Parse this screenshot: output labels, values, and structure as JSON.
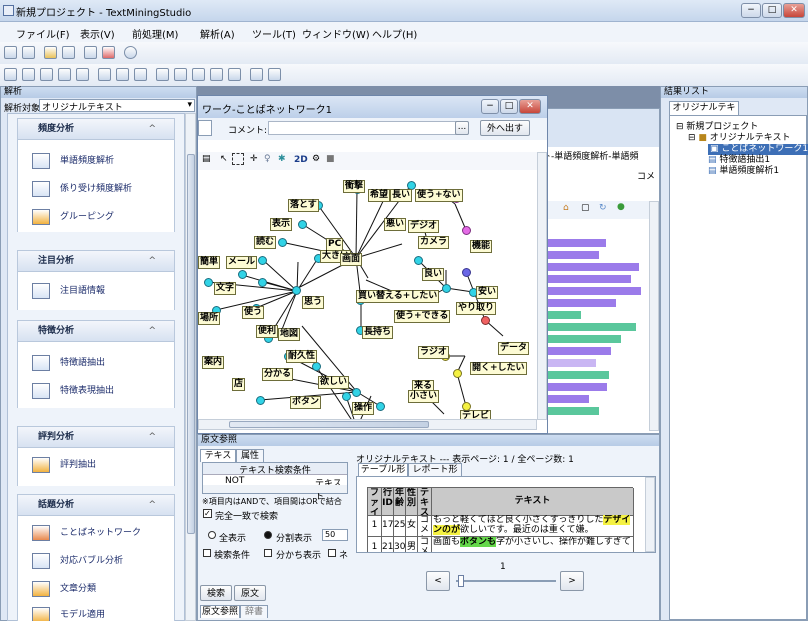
{
  "app": {
    "title": "新規プロジェクト - TextMiningStudio"
  },
  "window_controls": {
    "minimize": "−",
    "maximize": "□",
    "close": "✕"
  },
  "menu": {
    "items": [
      "ファイル(F)",
      "表示(V)",
      "前処理(M)",
      "解析(A)",
      "ツール(T)",
      "ウィンドウ(W)",
      "ヘルプ(H)"
    ]
  },
  "analysis_panel": {
    "title": "解析",
    "target_label": "解析対象",
    "target_value": "オリジナルテキスト",
    "groups": [
      {
        "title": "頻度分析",
        "items": [
          "単語頻度解析",
          "係り受け頻度解析",
          "グルーピング"
        ]
      },
      {
        "title": "注目分析",
        "items": [
          "注目語情報"
        ]
      },
      {
        "title": "特徴分析",
        "items": [
          "特徴語抽出",
          "特徴表現抽出"
        ]
      },
      {
        "title": "評判分析",
        "items": [
          "評判抽出"
        ]
      },
      {
        "title": "話題分析",
        "items": [
          "ことばネットワーク",
          "対応バブル分析",
          "文章分類",
          "モデル適用"
        ]
      }
    ],
    "collapse_icon": "^"
  },
  "network_window": {
    "title": "ワーク-ことばネットワーク1",
    "comment_label": "コメント:",
    "export_button": "外へ出す",
    "more_button": "...",
    "zoom_label": "2D",
    "nodes": [
      "衝撃",
      "希望",
      "長い",
      "使う+ない",
      "落とす",
      "悪い",
      "デジオ",
      "表示",
      "PC",
      "カメラ",
      "機能",
      "読む",
      "大きい",
      "画面",
      "メール",
      "良い",
      "文字",
      "思う",
      "買い替える+したい",
      "安い",
      "やり取り",
      "使う",
      "使う+できる",
      "便利",
      "地図",
      "長持ち",
      "データ",
      "場所",
      "ラジオ",
      "耐久性",
      "開く+したい",
      "案内",
      "分かる",
      "来る",
      "欲しい",
      "小さい",
      "店",
      "ボタン",
      "操作",
      "テレビ",
      "簡単"
    ]
  },
  "bg_window": {
    "title": "スト-単語頻度解析-単語頻",
    "label_right": "コメ"
  },
  "result_panel": {
    "title": "結果リスト",
    "tab": "オリジナルテキスト",
    "tree": [
      "新規プロジェクト",
      "オリジナルテキスト",
      "ことばネットワーク1",
      "特徴語抽出1",
      "単語頻度解析1"
    ]
  },
  "text_ref_panel": {
    "title": "原文参照",
    "tabs": [
      "テキスト",
      "属性"
    ],
    "search_condition_header": "テキスト検索条件",
    "cond_col1": "NOT",
    "cond_col2": "テキスト",
    "note": "※項目内はANDで、項目間はORで結合",
    "exact_match": "完全一致で検索",
    "radio_all": "全表示",
    "radio_split": "分割表示",
    "split_value": "50",
    "check_condition": "検索条件",
    "check_split": "分かち表示",
    "check_other": "ネ",
    "search_button": "検索",
    "original_button": "原文",
    "bottom_tabs": [
      "原文参照",
      "辞書"
    ],
    "page_info": "オリジナルテキスト --- 表示ページ: 1 / 全ページ数: 1",
    "view_tabs": [
      "テーブル形式",
      "レポート形式"
    ],
    "table_headers": [
      "ファイルID",
      "行ID",
      "年齢",
      "性別",
      "テキスト名",
      "テキスト"
    ],
    "rows": [
      {
        "file": "1",
        "row": "17",
        "age": "25",
        "sex": "女",
        "name": "コメント",
        "text_pre": "もっと軽くてほど良く小さくすっきりした",
        "text_hl": "デザインのが",
        "text_post": "欲しいです。最近のは重くて嫌。"
      },
      {
        "file": "1",
        "row": "21",
        "age": "30",
        "sex": "男",
        "name": "コメ",
        "text_pre": "画面も",
        "text_hl": "ボタンも",
        "text_post": "字が小さいし、操作が難しすぎて"
      }
    ],
    "page_num": "1",
    "prev": "<",
    "next": ">"
  },
  "colors": {
    "accent": "#3d6fb6",
    "bar_purple": "#9b7bea",
    "bar_green": "#5ac79c",
    "node_cyan": "#31d3e6",
    "highlight": "#f4f142"
  }
}
